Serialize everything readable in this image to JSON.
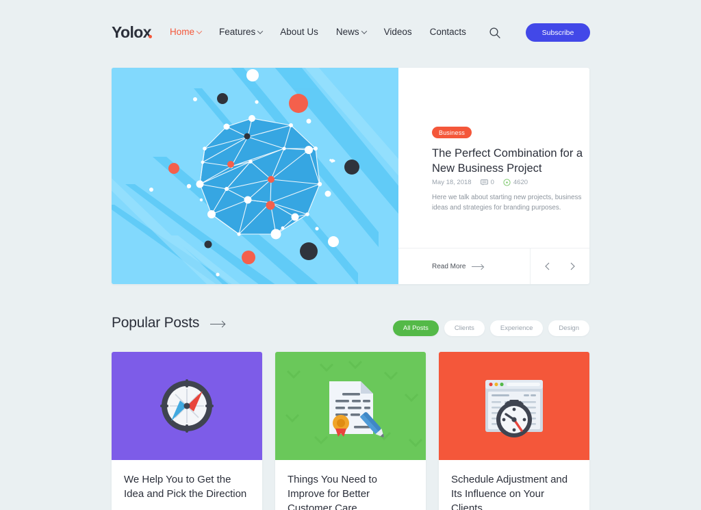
{
  "brand": {
    "name": "Yolox",
    "accent": "#f4573a"
  },
  "nav": {
    "items": [
      {
        "label": "Home",
        "caret": true,
        "active": true
      },
      {
        "label": "Features",
        "caret": true,
        "active": false
      },
      {
        "label": "About Us",
        "caret": false,
        "active": false
      },
      {
        "label": "News",
        "caret": true,
        "active": false
      },
      {
        "label": "Videos",
        "caret": false,
        "active": false
      },
      {
        "label": "Contacts",
        "caret": false,
        "active": false
      }
    ],
    "search_icon": "search-icon",
    "subscribe_label": "Subscribe",
    "subscribe_color": "#4248e8"
  },
  "hero": {
    "illustration": "network-sphere-illustration",
    "badge": "Business",
    "title": "The Perfect Combination for a New Business Project",
    "date": "May 18, 2018",
    "comments_icon": "comment-bubble-icon",
    "comments": "0",
    "views_icon": "views-icon",
    "views": "4620",
    "excerpt": "Here we talk about starting new projects, business ideas and strategies for branding purposes.",
    "read_more": "Read More",
    "prev_icon": "chevron-left-icon",
    "next_icon": "chevron-right-icon"
  },
  "section": {
    "title": "Popular Posts",
    "arrow_icon": "arrow-right-icon",
    "filters": [
      {
        "label": "All Posts",
        "active": true
      },
      {
        "label": "Clients",
        "active": false
      },
      {
        "label": "Experience",
        "active": false
      },
      {
        "label": "Design",
        "active": false
      }
    ],
    "filter_active_color": "#54b948"
  },
  "posts": [
    {
      "title": "We Help You to Get the Idea and Pick the Direction",
      "thumb_icon": "compass-icon",
      "thumb_color": "#7d5ce8"
    },
    {
      "title": "Things You Need to Improve for Better Customer Care",
      "thumb_icon": "certificate-pen-icon",
      "thumb_color": "#6ac85a"
    },
    {
      "title": "Schedule Adjustment and Its Influence on Your Clients",
      "thumb_icon": "browser-stopwatch-icon",
      "thumb_color": "#f4573a"
    }
  ]
}
